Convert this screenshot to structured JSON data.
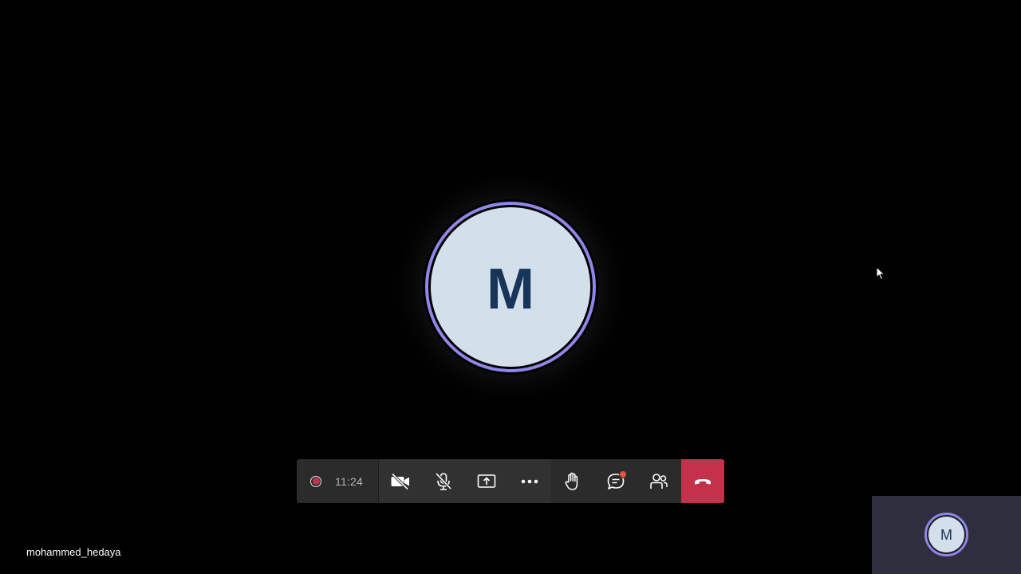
{
  "meeting": {
    "participant_initial": "M",
    "self_initial": "M",
    "participant_name": "mohammed_hedaya"
  },
  "toolbar": {
    "recording_indicator": "recording-dot",
    "elapsed_time": "11:24",
    "buttons": [
      {
        "name": "camera-off-button",
        "icon": "video-off-icon"
      },
      {
        "name": "mic-muted-button",
        "icon": "mic-off-icon"
      },
      {
        "name": "share-screen-button",
        "icon": "share-tray-icon"
      },
      {
        "name": "more-actions-button",
        "icon": "more-icon"
      },
      {
        "name": "raise-hand-button",
        "icon": "hand-icon"
      },
      {
        "name": "chat-button",
        "icon": "chat-icon",
        "has_notification": true
      },
      {
        "name": "participants-button",
        "icon": "people-icon"
      },
      {
        "name": "hang-up-button",
        "icon": "phone-hangup-icon"
      }
    ]
  },
  "colors": {
    "background": "#000000",
    "avatar_ring": "#8f86e8",
    "avatar_fill": "#d4dfec",
    "avatar_text": "#173559",
    "hangup": "#c4314b",
    "notification": "#e3553e"
  }
}
